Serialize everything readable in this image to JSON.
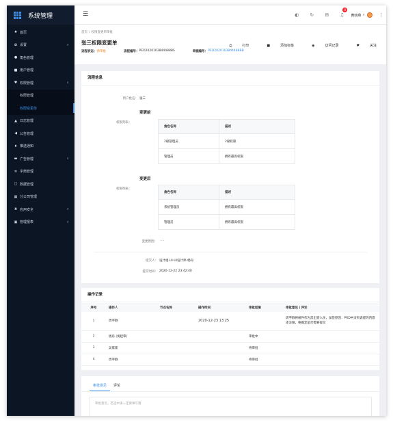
{
  "app": {
    "title": "系统管理"
  },
  "sidebar": {
    "items": [
      {
        "icon": "home-icon",
        "glyph": "♠",
        "label": "首页",
        "arrow": ""
      },
      {
        "icon": "gear-icon",
        "glyph": "✿",
        "label": "设置",
        "arrow": "∨"
      },
      {
        "icon": "user-icon",
        "glyph": "●",
        "label": "角色管理",
        "arrow": ""
      },
      {
        "icon": "user-card-icon",
        "glyph": "■",
        "label": "用户管理",
        "arrow": ""
      },
      {
        "icon": "shield-icon",
        "glyph": "♥",
        "label": "权限管理",
        "arrow": "∧"
      }
    ],
    "subitems": [
      {
        "label": "权限管理",
        "active": false
      },
      {
        "label": "权限变更单",
        "active": true
      }
    ],
    "items2": [
      {
        "icon": "chart-icon",
        "glyph": "▲",
        "label": "日志管理",
        "arrow": ""
      },
      {
        "icon": "megaphone-icon",
        "glyph": "◀",
        "label": "公告管理",
        "arrow": ""
      },
      {
        "icon": "bell-icon",
        "glyph": "♦",
        "label": "推送通知",
        "arrow": ""
      },
      {
        "icon": "image-icon",
        "glyph": "▬",
        "label": "广告管理",
        "arrow": "∨"
      },
      {
        "icon": "list-icon",
        "glyph": "≡",
        "label": "字典管理",
        "arrow": ""
      },
      {
        "icon": "database-icon",
        "glyph": "□",
        "label": "数据管理",
        "arrow": ""
      },
      {
        "icon": "grid-icon",
        "glyph": "▦",
        "label": "分公司管理",
        "arrow": ""
      },
      {
        "icon": "lock-icon",
        "glyph": "♣",
        "label": "应用安全",
        "arrow": "∨"
      },
      {
        "icon": "report-icon",
        "glyph": "▣",
        "label": "管理报表",
        "arrow": "∨"
      }
    ]
  },
  "topbar": {
    "icons": [
      {
        "name": "bulb-icon",
        "glyph": "◐"
      },
      {
        "name": "refresh-icon",
        "glyph": "↻"
      },
      {
        "name": "apps-icon",
        "glyph": "⊞"
      },
      {
        "name": "bell-icon",
        "glyph": "♫"
      }
    ],
    "notification_count": "8",
    "user_name": "黄晓燕",
    "more_glyph": "⋮"
  },
  "page": {
    "breadcrumb": [
      "首页",
      "权限变更单审批"
    ],
    "title": "张三权限变更单",
    "status_label": "流程状态：",
    "status_value": "待审批",
    "flow_no_label": "流程编号：",
    "flow_no_value": "PEO2020103844488BS",
    "order_no_label": "单据编号：",
    "order_no_value": "PEO2020103844488BB",
    "actions": [
      {
        "name": "print-button",
        "glyph": "⎙",
        "label": "打印"
      },
      {
        "name": "add-tag-button",
        "glyph": "■",
        "label": "添加标签"
      },
      {
        "name": "history-button",
        "glyph": "◉",
        "label": "访问记录"
      },
      {
        "name": "follow-button",
        "glyph": "♥",
        "label": "关注"
      }
    ]
  },
  "flow_info": {
    "title": "流程信息",
    "user_label": "用户姓名：",
    "user_value": "张三",
    "before": {
      "title": "变更前",
      "list_label": "权限列表：",
      "headers": [
        "角色名称",
        "描述"
      ],
      "rows": [
        [
          "2级管理员",
          "2级权限"
        ],
        [
          "管理员",
          "拥有最高权限"
        ]
      ]
    },
    "after": {
      "title": "变更后",
      "list_label": "权限列表：",
      "headers": [
        "角色名称",
        "描述"
      ],
      "rows": [
        [
          "系统管理员",
          "拥有最高权限"
        ],
        [
          "管理员",
          "拥有最高权限"
        ]
      ]
    },
    "reason_label": "变更原因：",
    "reason_value": "- -",
    "submitter_label": "提交人：",
    "submitter_value": "设计组-UI-UI设计师-杨丹",
    "submit_time_label": "提交时间：",
    "submit_time_value": "2020-12-22 23:42:40"
  },
  "op_records": {
    "title": "操作记录",
    "headers": [
      "序号",
      "操作人",
      "节点名称",
      "操作时间",
      "审批结果",
      "审批意见丨评论"
    ],
    "rows": [
      {
        "no": "1",
        "operator": "周宇静",
        "node": "",
        "time": "2020-12-23 13:25",
        "result": "",
        "comment": "周宇静将被件作为黑出受人员，加签原因：PRD中没有说提的内容还没做，要确定是否需要提交"
      },
      {
        "no": "2",
        "operator": "杨丹 (发起审)",
        "node": "",
        "time": "",
        "result": "审批中",
        "comment": ""
      },
      {
        "no": "3",
        "operator": "吴家家",
        "node": "",
        "time": "",
        "result": "待审批",
        "comment": ""
      },
      {
        "no": "4",
        "operator": "周宇静",
        "node": "",
        "time": "",
        "result": "待审批",
        "comment": ""
      }
    ]
  },
  "review": {
    "tabs": [
      "审批意见",
      "评论"
    ],
    "placeholder": "审批意见，若选中请一定要填写哦"
  }
}
